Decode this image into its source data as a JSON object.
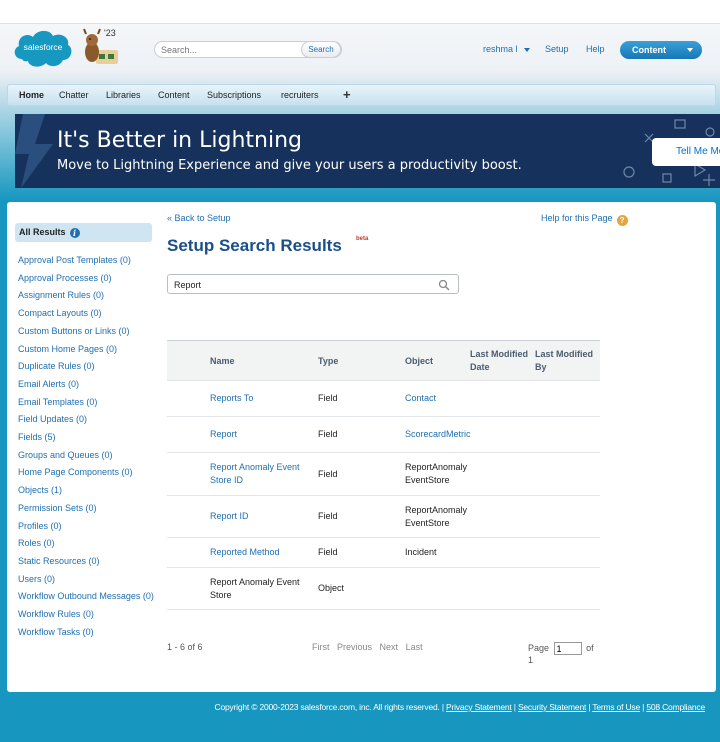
{
  "header": {
    "logo_text": "salesforce",
    "mascot_year": "'23",
    "search": {
      "placeholder": "Search...",
      "button_label": "Search"
    },
    "user_menu": "reshma l",
    "setup_link": "Setup",
    "help_link": "Help",
    "app_picker": "Content"
  },
  "tabs": [
    "Home",
    "Chatter",
    "Libraries",
    "Content",
    "Subscriptions",
    "recruiters"
  ],
  "banner": {
    "title": "It's Better in Lightning",
    "subtitle": "Move to Lightning Experience and give your users a productivity boost.",
    "button": "Tell Me More"
  },
  "sidebar": {
    "heading": "All Results",
    "items": [
      "Approval Post Templates (0)",
      "Approval Processes (0)",
      "Assignment Rules (0)",
      "Compact Layouts (0)",
      "Custom Buttons or Links (0)",
      "Custom Home Pages (0)",
      "Duplicate Rules (0)",
      "Email Alerts (0)",
      "Email Templates (0)",
      "Field Updates (0)",
      "Fields (5)",
      "Groups and Queues (0)",
      "Home Page Components (0)",
      "Objects (1)",
      "Permission Sets (0)",
      "Profiles (0)",
      "Roles (0)",
      "Static Resources (0)",
      "Users (0)",
      "Workflow Outbound Messages (0)",
      "Workflow Rules (0)",
      "Workflow Tasks (0)"
    ]
  },
  "main": {
    "back_link": "« Back to Setup",
    "help_link": "Help for this Page",
    "title": "Setup Search Results",
    "beta": "beta",
    "search_value": "Report",
    "columns": [
      "Name",
      "Type",
      "Object",
      "Last Modified Date",
      "Last Modified By"
    ],
    "rows": [
      {
        "name": "Reports To",
        "type": "Field",
        "object": "Contact"
      },
      {
        "name": "Report",
        "type": "Field",
        "object": "ScorecardMetric"
      },
      {
        "name": "Report Anomaly Event Store ID",
        "type": "Field",
        "object": "ReportAnomalyEventStore"
      },
      {
        "name": "Report ID",
        "type": "Field",
        "object": "ReportAnomalyEventStore"
      },
      {
        "name": "Reported Method",
        "type": "Field",
        "object": "Incident"
      },
      {
        "name": "Report Anomaly Event Store",
        "type": "Object",
        "object": ""
      }
    ],
    "pager": {
      "count": "1 - 6 of 6",
      "first": "First",
      "previous": "Previous",
      "next": "Next",
      "last": "Last",
      "page_label": "Page",
      "page_value": "1",
      "of_label": "of 1"
    }
  },
  "footer": {
    "copyright": "Copyright © 2000-2023 salesforce.com, inc. All rights reserved. |",
    "links": [
      "Privacy Statement",
      "Security Statement",
      "Terms of Use",
      "508 Compliance"
    ]
  }
}
